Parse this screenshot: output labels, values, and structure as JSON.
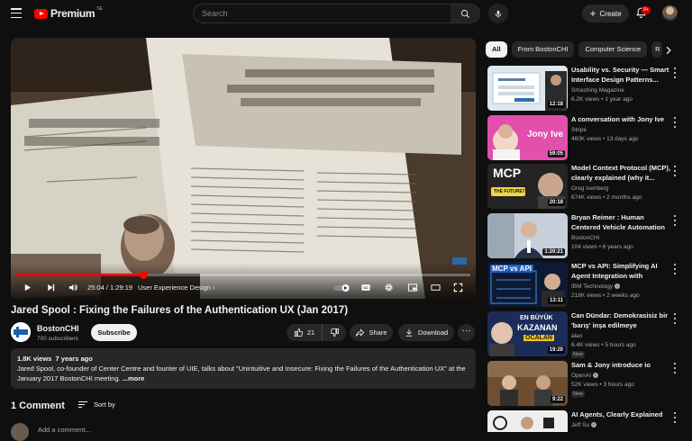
{
  "header": {
    "logo_text": "Premium",
    "logo_country": "SE",
    "search_placeholder": "Search",
    "create_label": "Create",
    "notifications_badge": "9+"
  },
  "player": {
    "current_time": "25:04",
    "duration": "1:29:19",
    "time_separator": " / ",
    "chapter": "User Experience Design",
    "progress": 0.2805
  },
  "video": {
    "title": "Jared Spool : Fixing the Failures of the Authentication UX (Jan 2017)",
    "channel": "BostonCHI",
    "subscribers": "700 subscribers",
    "subscribe_label": "Subscribe",
    "likes": "21",
    "share_label": "Share",
    "download_label": "Download",
    "views": "1.8K views",
    "age": "7 years ago",
    "description": "Jared Spool, co-founder of Center Centre and founter of UIE, talks about \"Unintuitive and Insecure: Fixing the Failures of the Authentication UX\" at the January 2017 BostonCHI meeting.",
    "more_label": "...more"
  },
  "comments": {
    "heading": "1 Comment",
    "sort_label": "Sort by",
    "add_placeholder": "Add a comment..."
  },
  "chips": [
    "All",
    "From BostonCHI",
    "Computer Science",
    "R"
  ],
  "recommendations": [
    {
      "title": "Usability vs. Security — Smart Interface Design Patterns...",
      "channel": "Smashing Magazine",
      "meta": "6.2K views • 1 year ago",
      "duration": "12:18",
      "new": ""
    },
    {
      "title": "A conversation with Jony Ive",
      "channel": "Stripe",
      "meta": "460K views • 13 days ago",
      "duration": "59:05",
      "new": ""
    },
    {
      "title": "Model Context Protocol (MCP), clearly explained (why it...",
      "channel": "Greg Isenberg",
      "meta": "674K views • 2 months ago",
      "duration": "20:18",
      "new": ""
    },
    {
      "title": "Bryan Reimer : Human Centered Vehicle Automation (Novembe...",
      "channel": "BostonCHI",
      "meta": "104 views • 6 years ago",
      "duration": "1:20:21",
      "new": ""
    },
    {
      "title": "MCP vs API: Simplifying AI Agent Integration with Externa...",
      "channel": "IBM Technology",
      "meta": "218K views • 2 weeks ago",
      "duration": "13:11",
      "new": "",
      "verified": true
    },
    {
      "title": "Can Dündar: Demokrasisiz bir 'barış' inşa edilmeye çalışılıyor...",
      "channel": "alan",
      "meta": "6.4K views • 5 hours ago",
      "duration": "19:20",
      "new": "New"
    },
    {
      "title": "Sam & Jony introduce io",
      "channel": "OpenAI",
      "meta": "52K views • 3 hours ago",
      "duration": "9:22",
      "new": "New",
      "verified": true
    },
    {
      "title": "AI Agents, Clearly Explained",
      "channel": "Jeff Su",
      "meta": "",
      "duration": "",
      "new": "",
      "verified": true
    }
  ],
  "thumb_texts": {
    "jony": "Jony Ive",
    "mcp": "MCP",
    "mcp_sub": "THE FUTURE?",
    "mcpapi": "MCP vs API",
    "turk1": "EN BÜYÜK",
    "turk2": "KAZANAN",
    "turk3": "OCALAN"
  },
  "colors": {
    "accent": "#ff0000",
    "background": "#0f0f0f",
    "surface": "#272727"
  }
}
